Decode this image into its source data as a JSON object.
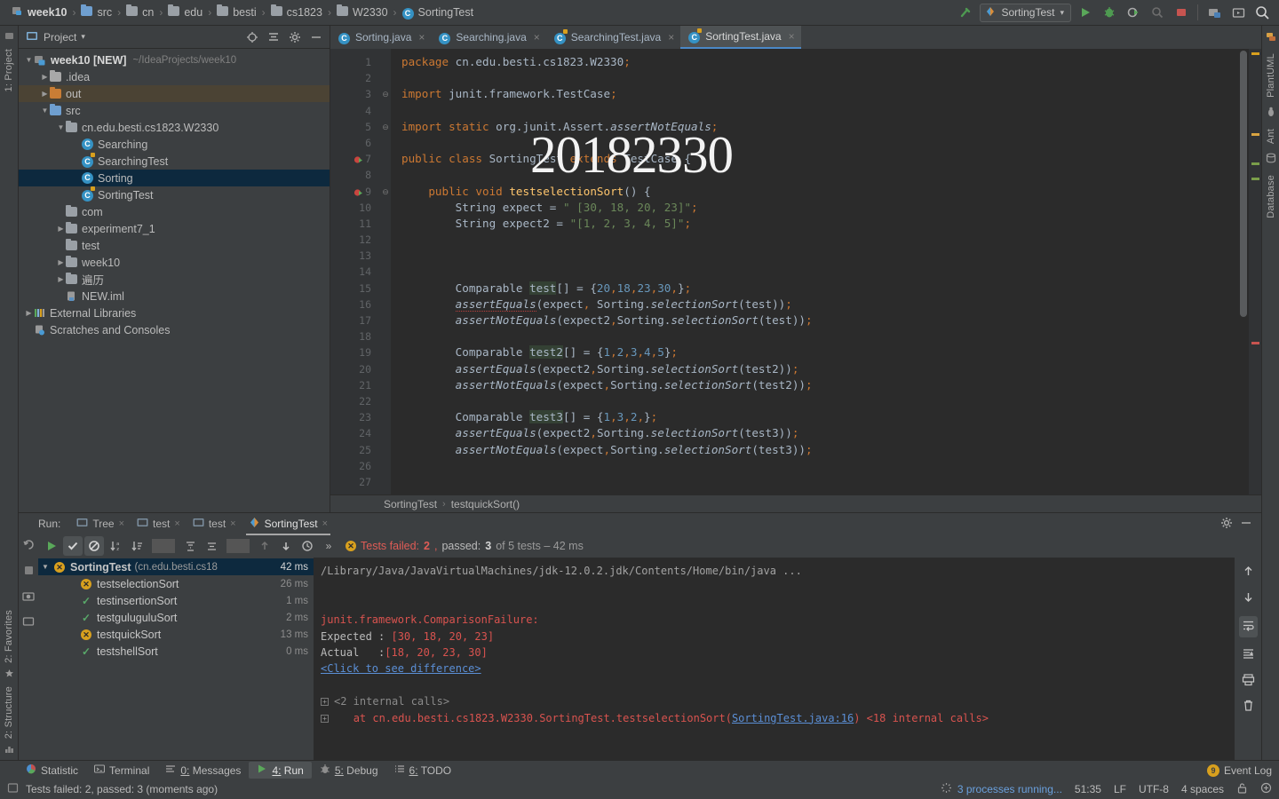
{
  "navbar": {
    "breadcrumbs": [
      {
        "label": "week10",
        "icon": "module-icon"
      },
      {
        "label": "src",
        "icon": "source-folder-icon"
      },
      {
        "label": "cn",
        "icon": "package-icon"
      },
      {
        "label": "edu",
        "icon": "package-icon"
      },
      {
        "label": "besti",
        "icon": "package-icon"
      },
      {
        "label": "cs1823",
        "icon": "package-icon"
      },
      {
        "label": "W2330",
        "icon": "package-icon"
      },
      {
        "label": "SortingTest",
        "icon": "java-class-icon"
      }
    ],
    "separator": "›",
    "run_configuration": "SortingTest",
    "dropdown_caret": "▾",
    "buttons": [
      {
        "name": "build-hammer-icon"
      },
      {
        "name": "run-button"
      },
      {
        "name": "debug-button"
      },
      {
        "name": "run-with-coverage-button"
      },
      {
        "name": "profiler-button"
      },
      {
        "name": "stop-button"
      },
      {
        "name": "update-project-button"
      },
      {
        "name": "open-console-button"
      },
      {
        "name": "search-everywhere-icon"
      }
    ]
  },
  "left_strip": {
    "top": [
      "1: Project"
    ],
    "bottom": [
      "2: Structure",
      "2: Favorites"
    ]
  },
  "right_strip": {
    "items": [
      "PlantUML",
      "Ant",
      "Database"
    ]
  },
  "project_panel": {
    "title": "Project",
    "title_caret": "▾",
    "header_icons": [
      "locate-icon",
      "collapse-all-icon",
      "settings-gear-icon",
      "hide-icon"
    ],
    "tree": [
      {
        "depth": 0,
        "arrow": "▼",
        "icon": "module-icon",
        "name": "week10 [NEW]",
        "bold": true,
        "sub": "~/IdeaProjects/week10",
        "state": "normal"
      },
      {
        "depth": 1,
        "arrow": "▶",
        "icon": "folder-grey-icon",
        "name": ".idea",
        "sub": "",
        "state": "normal"
      },
      {
        "depth": 1,
        "arrow": "▶",
        "icon": "folder-orange-icon",
        "name": "out",
        "sub": "",
        "state": "highlight"
      },
      {
        "depth": 1,
        "arrow": "▼",
        "icon": "source-folder-icon",
        "name": "src",
        "sub": "",
        "state": "normal"
      },
      {
        "depth": 2,
        "arrow": "▼",
        "icon": "package-icon",
        "name": "cn.edu.besti.cs1823.W2330",
        "sub": "",
        "state": "normal"
      },
      {
        "depth": 3,
        "arrow": "",
        "icon": "java-class-icon",
        "name": "Searching",
        "sub": "",
        "state": "normal"
      },
      {
        "depth": 3,
        "arrow": "",
        "icon": "java-test-class-icon",
        "name": "SearchingTest",
        "sub": "",
        "state": "normal"
      },
      {
        "depth": 3,
        "arrow": "",
        "icon": "java-class-icon",
        "name": "Sorting",
        "sub": "",
        "state": "selected"
      },
      {
        "depth": 3,
        "arrow": "",
        "icon": "java-test-class-icon",
        "name": "SortingTest",
        "sub": "",
        "state": "normal"
      },
      {
        "depth": 2,
        "arrow": "",
        "icon": "package-icon",
        "name": "com",
        "sub": "",
        "state": "normal"
      },
      {
        "depth": 2,
        "arrow": "▶",
        "icon": "package-icon",
        "name": "experiment7_1",
        "sub": "",
        "state": "normal"
      },
      {
        "depth": 2,
        "arrow": "",
        "icon": "package-icon",
        "name": "test",
        "sub": "",
        "state": "normal"
      },
      {
        "depth": 2,
        "arrow": "▶",
        "icon": "package-icon",
        "name": "week10",
        "sub": "",
        "state": "normal"
      },
      {
        "depth": 2,
        "arrow": "▶",
        "icon": "package-icon",
        "name": "遍历",
        "sub": "",
        "state": "normal"
      },
      {
        "depth": 2,
        "arrow": "",
        "icon": "iml-file-icon",
        "name": "NEW.iml",
        "sub": "",
        "state": "normal"
      },
      {
        "depth": 0,
        "arrow": "▶",
        "icon": "external-libraries-icon",
        "name": "External Libraries",
        "sub": "",
        "state": "normal"
      },
      {
        "depth": 0,
        "arrow": "",
        "icon": "scratches-icon",
        "name": "Scratches and Consoles",
        "sub": "",
        "state": "normal"
      }
    ]
  },
  "editor": {
    "tabs": [
      {
        "label": "Sorting.java",
        "icon": "java-class-icon",
        "active": false
      },
      {
        "label": "Searching.java",
        "icon": "java-class-icon",
        "active": false
      },
      {
        "label": "SearchingTest.java",
        "icon": "java-test-class-icon",
        "active": false
      },
      {
        "label": "SortingTest.java",
        "icon": "java-test-class-icon",
        "active": true
      }
    ],
    "tab_close": "×",
    "watermark": "20182330",
    "breadcrumb": [
      "SortingTest",
      "testquickSort()"
    ],
    "breadcrumb_sep": "›",
    "lines": [
      {
        "n": 1,
        "gutter": "",
        "fold": "",
        "html": "<span class=\"k\">package</span> cn.edu.besti.cs1823.W2330<span class=\"k\">;</span>"
      },
      {
        "n": 2,
        "gutter": "",
        "fold": "",
        "html": ""
      },
      {
        "n": 3,
        "gutter": "",
        "fold": "⊖",
        "html": "<span class=\"k\">import</span> junit.framework.TestCase<span class=\"k\">;</span>"
      },
      {
        "n": 4,
        "gutter": "",
        "fold": "",
        "html": ""
      },
      {
        "n": 5,
        "gutter": "",
        "fold": "⊖",
        "html": "<span class=\"k\">import static</span> org.junit.Assert.<span class=\"fi\">assertNotEquals</span><span class=\"k\">;</span>"
      },
      {
        "n": 6,
        "gutter": "",
        "fold": "",
        "html": ""
      },
      {
        "n": 7,
        "gutter": "run",
        "fold": "",
        "html": "<span class=\"k\">public class</span> SortingTest <span class=\"k\">extends</span> TestCase {"
      },
      {
        "n": 8,
        "gutter": "",
        "fold": "",
        "html": ""
      },
      {
        "n": 9,
        "gutter": "run",
        "fold": "⊖",
        "html": "    <span class=\"k\">public void</span> <span class=\"m\">testselectionSort</span>() {"
      },
      {
        "n": 10,
        "gutter": "",
        "fold": "",
        "html": "        String expect = <span class=\"s\">\" [30, 18, 20, 23]\"</span><span class=\"k\">;</span>"
      },
      {
        "n": 11,
        "gutter": "",
        "fold": "",
        "html": "        String expect2 = <span class=\"s\">\"[1, 2, 3, 4, 5]\"</span><span class=\"k\">;</span>"
      },
      {
        "n": 12,
        "gutter": "",
        "fold": "",
        "html": ""
      },
      {
        "n": 13,
        "gutter": "",
        "fold": "",
        "html": ""
      },
      {
        "n": 14,
        "gutter": "",
        "fold": "",
        "html": ""
      },
      {
        "n": 15,
        "gutter": "",
        "fold": "",
        "html": "        Comparable <span class=\"var\">test</span>[] = {<span class=\"n\">20</span><span class=\"k\">,</span><span class=\"n\">18</span><span class=\"k\">,</span><span class=\"n\">23</span><span class=\"k\">,</span><span class=\"n\">30</span><span class=\"k\">,</span>}<span class=\"k\">;</span>"
      },
      {
        "n": 16,
        "gutter": "",
        "fold": "",
        "html": "        <span class=\"fi err\">assertEquals</span>(expect<span class=\"k\">,</span> Sorting.<span class=\"fi\">selectionSort</span>(test))<span class=\"k\">;</span>"
      },
      {
        "n": 17,
        "gutter": "",
        "fold": "",
        "html": "        <span class=\"fi\">assertNotEquals</span>(expect2<span class=\"k\">,</span>Sorting.<span class=\"fi\">selectionSort</span>(test))<span class=\"k\">;</span>"
      },
      {
        "n": 18,
        "gutter": "",
        "fold": "",
        "html": ""
      },
      {
        "n": 19,
        "gutter": "",
        "fold": "",
        "html": "        Comparable <span class=\"var\">test2</span>[] = {<span class=\"n\">1</span><span class=\"k\">,</span><span class=\"n\">2</span><span class=\"k\">,</span><span class=\"n\">3</span><span class=\"k\">,</span><span class=\"n\">4</span><span class=\"k\">,</span><span class=\"n\">5</span>}<span class=\"k\">;</span>"
      },
      {
        "n": 20,
        "gutter": "",
        "fold": "",
        "html": "        <span class=\"fi\">assertEquals</span>(expect2<span class=\"k\">,</span>Sorting.<span class=\"fi\">selectionSort</span>(test2))<span class=\"k\">;</span>"
      },
      {
        "n": 21,
        "gutter": "",
        "fold": "",
        "html": "        <span class=\"fi\">assertNotEquals</span>(expect<span class=\"k\">,</span>Sorting.<span class=\"fi\">selectionSort</span>(test2))<span class=\"k\">;</span>"
      },
      {
        "n": 22,
        "gutter": "",
        "fold": "",
        "html": ""
      },
      {
        "n": 23,
        "gutter": "",
        "fold": "",
        "html": "        Comparable <span class=\"var\">test3</span>[] = {<span class=\"n\">1</span><span class=\"k\">,</span><span class=\"n\">3</span><span class=\"k\">,</span><span class=\"n\">2</span><span class=\"k\">,</span>}<span class=\"k\">;</span>"
      },
      {
        "n": 24,
        "gutter": "",
        "fold": "",
        "html": "        <span class=\"fi\">assertEquals</span>(expect2<span class=\"k\">,</span>Sorting.<span class=\"fi\">selectionSort</span>(test3))<span class=\"k\">;</span>"
      },
      {
        "n": 25,
        "gutter": "",
        "fold": "",
        "html": "        <span class=\"fi\">assertNotEquals</span>(expect<span class=\"k\">,</span>Sorting.<span class=\"fi\">selectionSort</span>(test3))<span class=\"k\">;</span>"
      },
      {
        "n": 26,
        "gutter": "",
        "fold": "",
        "html": ""
      },
      {
        "n": 27,
        "gutter": "",
        "fold": "",
        "html": ""
      }
    ]
  },
  "run_panel": {
    "lead_label": "Run:",
    "tabs": [
      {
        "label": "Tree",
        "icon": "console-icon",
        "active": false,
        "close": "×"
      },
      {
        "label": "test",
        "icon": "console-icon",
        "active": false,
        "close": "×"
      },
      {
        "label": "test",
        "icon": "console-icon",
        "active": false,
        "close": "×"
      },
      {
        "label": "SortingTest",
        "icon": "test-run-icon",
        "active": true,
        "close": "×"
      }
    ],
    "header_icons": [
      "settings-gear-icon",
      "hide-panel-icon"
    ],
    "toolbar": [
      {
        "name": "rerun-button",
        "glyph": "▶"
      },
      {
        "name": "show-passed-toggle",
        "glyph": "✓"
      },
      {
        "name": "show-ignored-toggle",
        "glyph": "⊘"
      },
      {
        "name": "sort-alphabetically-button",
        "glyph": "↓"
      },
      {
        "name": "sort-by-duration-button",
        "glyph": "↓"
      },
      {
        "name": "expand-all-button",
        "glyph": "⤓"
      },
      {
        "name": "collapse-all-button",
        "glyph": "⤒"
      },
      {
        "name": "prev-failed-test-button",
        "glyph": "↑"
      },
      {
        "name": "next-failed-test-button",
        "glyph": "↓"
      },
      {
        "name": "test-history-button",
        "glyph": "◷"
      },
      {
        "name": "more-options-button",
        "glyph": "»"
      }
    ],
    "status": {
      "prefix": "Tests failed:",
      "failed": "2",
      "passed_label": "passed:",
      "passed": "3",
      "suffix": "of 5 tests – 42 ms"
    },
    "left_strip_icons": [
      "rerun-failed-icon",
      "stop-icon",
      "screenshot-icon",
      "export-icon"
    ],
    "right_strip_icons": [
      "scroll-up-icon",
      "scroll-down-icon",
      "soft-wrap-icon",
      "scroll-to-end-icon",
      "print-icon",
      "clear-all-icon"
    ],
    "test_tree": {
      "root": {
        "name": "SortingTest",
        "pkg": "(cn.edu.besti.cs18",
        "time": "42 ms",
        "status": "failed",
        "arrow": "▼"
      },
      "children": [
        {
          "name": "testselectionSort",
          "time": "26 ms",
          "status": "failed"
        },
        {
          "name": "testinsertionSort",
          "time": "1 ms",
          "status": "passed"
        },
        {
          "name": "testguluguluSort",
          "time": "2 ms",
          "status": "passed"
        },
        {
          "name": "testquickSort",
          "time": "13 ms",
          "status": "failed"
        },
        {
          "name": "testshellSort",
          "time": "0 ms",
          "status": "passed"
        }
      ]
    },
    "console": {
      "command": "/Library/Java/JavaVirtualMachines/jdk-12.0.2.jdk/Contents/Home/bin/java ...",
      "exception": "junit.framework.ComparisonFailure:",
      "expected_label": "Expected :",
      "expected_value": "[30, 18, 20, 23]",
      "actual_label": "Actual   :",
      "actual_value": "[18, 20, 23, 30]",
      "diff_link": "<Click to see difference>",
      "internal_calls_1": "<2 internal calls>",
      "stack_at": "at cn.edu.besti.cs1823.W2330.SortingTest.testselectionSort(",
      "stack_link": "SortingTest.java:16",
      "stack_tail": ") <18 internal calls>"
    }
  },
  "toolwindow_bar": {
    "items": [
      {
        "label": "Statistic",
        "icon": "statistic-icon",
        "active": false,
        "mnemonic": ""
      },
      {
        "label": "Terminal",
        "icon": "terminal-icon",
        "active": false,
        "mnemonic": ""
      },
      {
        "label": "Messages",
        "icon": "messages-icon",
        "active": false,
        "mnemonic": "0:"
      },
      {
        "label": "Run",
        "icon": "run-icon",
        "active": true,
        "mnemonic": "4:"
      },
      {
        "label": "Debug",
        "icon": "debug-icon",
        "active": false,
        "mnemonic": "5:"
      },
      {
        "label": "TODO",
        "icon": "todo-icon",
        "active": false,
        "mnemonic": "6:"
      }
    ],
    "event_log": {
      "label": "Event Log",
      "badge": "9"
    }
  },
  "statusbar": {
    "message": "Tests failed: 2, passed: 3 (moments ago)",
    "processes": "3 processes running...",
    "position": "51:35",
    "line_separator": "LF",
    "encoding": "UTF-8",
    "indent": "4 spaces",
    "icons": [
      "lock-icon",
      "inspection-icon"
    ]
  },
  "colors": {
    "accent_blue": "#4a88c7",
    "selection_blue": "#0d293e",
    "fail_red": "#e05c56",
    "pass_green": "#59a869",
    "editor_bg": "#2b2b2b",
    "panel_bg": "#3c3f41"
  }
}
